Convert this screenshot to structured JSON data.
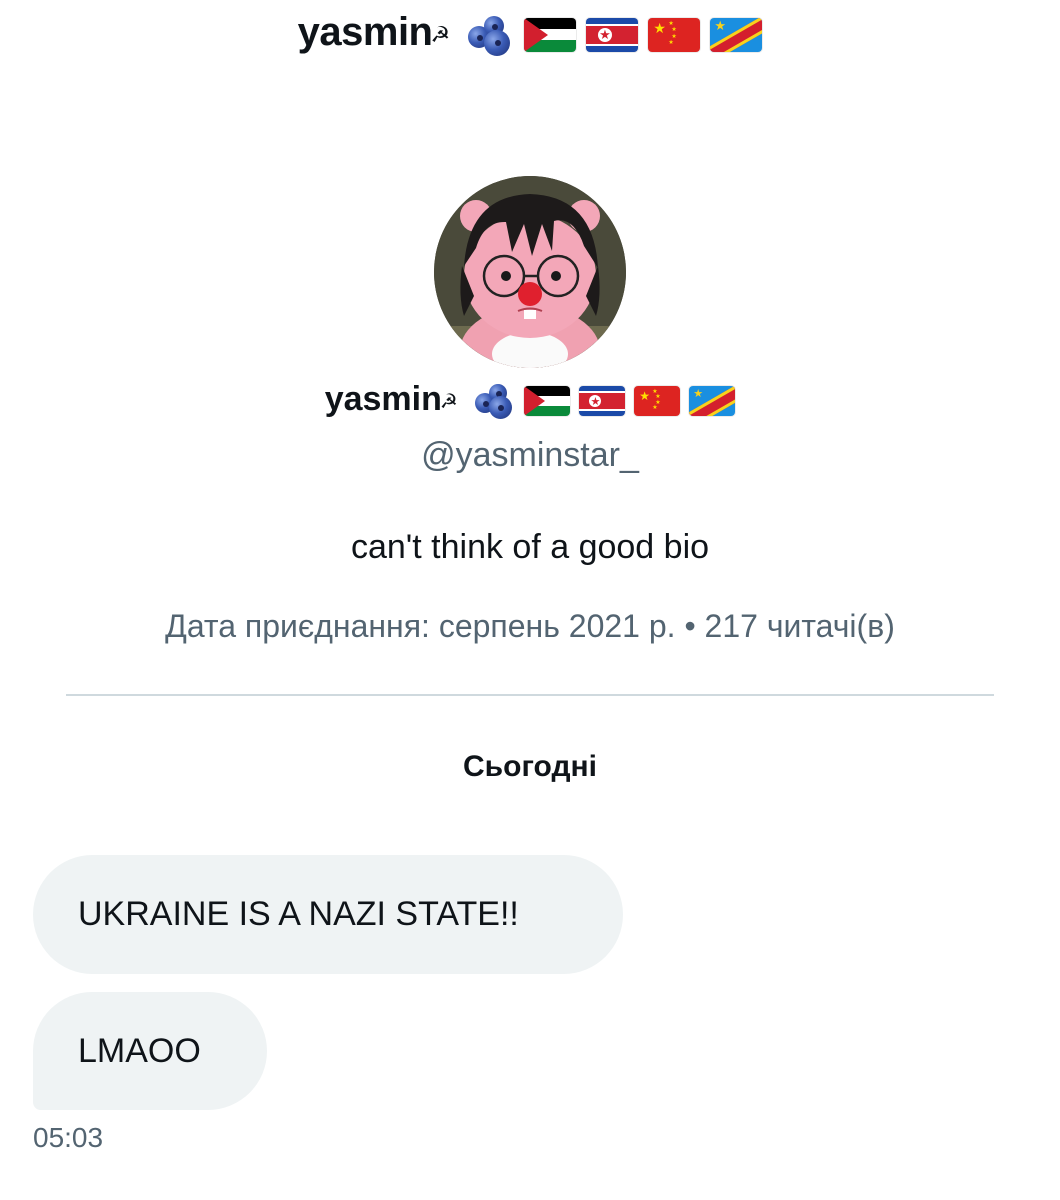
{
  "header": {
    "title": "yasmin",
    "emojis": [
      "hammer-and-sickle-icon",
      "blueberries-icon",
      "flag-palestine-icon",
      "flag-north-korea-icon",
      "flag-china-icon",
      "flag-dr-congo-icon"
    ],
    "hammer_sickle": "☭"
  },
  "profile": {
    "display_name": "yasmin",
    "hammer_sickle": "☭",
    "handle": "@yasminstar_",
    "bio": "can't think of a good bio",
    "join_info": "Дата приєднання: серпень 2021 р. • 217 читачі(в)"
  },
  "conversation": {
    "date_header": "Сьогодні",
    "messages": [
      {
        "text": "UKRAINE IS A NAZI STATE!!"
      },
      {
        "text": "LMAOO"
      }
    ],
    "timestamp": "05:03"
  },
  "colors": {
    "text_primary": "#0f1419",
    "text_secondary": "#536471",
    "bubble_bg": "#eff3f4",
    "divider": "#cfd9de"
  }
}
